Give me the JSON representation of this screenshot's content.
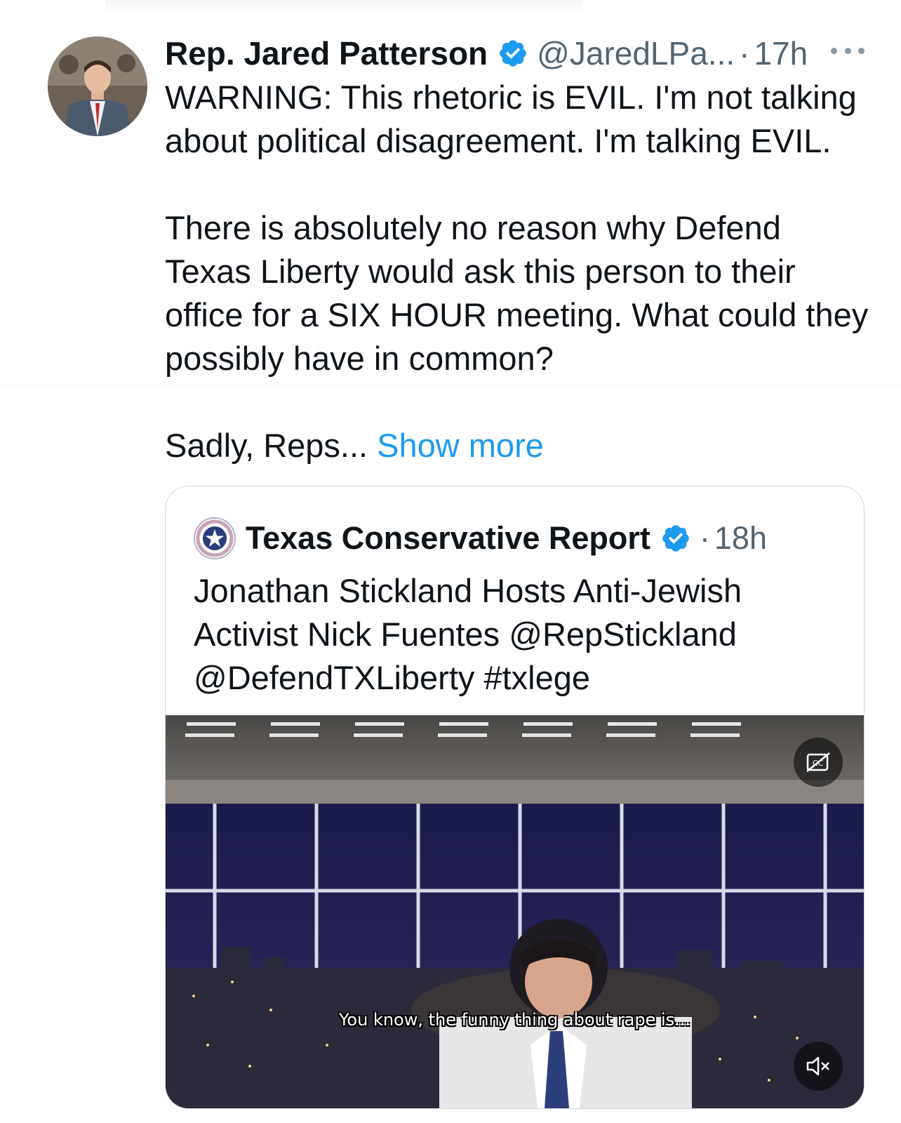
{
  "tweet": {
    "author": {
      "display_name": "Rep. Jared Patterson",
      "handle": "@JaredLPa...",
      "verified_icon": "verified-badge-icon",
      "separator": "·",
      "time": "17h"
    },
    "text": {
      "paragraph1": "WARNING: This rhetoric is EVIL. I'm not talking about political disagreement. I'm talking EVIL.",
      "paragraph2": "There is absolutely no reason why Defend Texas Liberty would ask this person to their office for a SIX HOUR meeting. What could they possibly have in common?",
      "paragraph3_prefix": "Sadly, Reps...",
      "show_more": "Show more"
    },
    "more_icon": "more-options-icon"
  },
  "quote": {
    "author": {
      "display_name": "Texas Conservative Report",
      "separator": "·",
      "time": "18h",
      "verified_icon": "verified-badge-icon"
    },
    "text": "Jonathan Stickland Hosts Anti-Jewish Activist Nick Fuentes @RepStickland @DefendTXLiberty #txlege",
    "video": {
      "subtitle": "You know, the funny thing about rape is...",
      "cc_icon": "captions-off-icon",
      "mute_icon": "muted-speaker-icon"
    }
  },
  "colors": {
    "text_primary": "#0f1419",
    "text_secondary": "#536471",
    "link": "#1d9bf0",
    "verified": "#1d9bf0",
    "border": "#cfd9de"
  }
}
